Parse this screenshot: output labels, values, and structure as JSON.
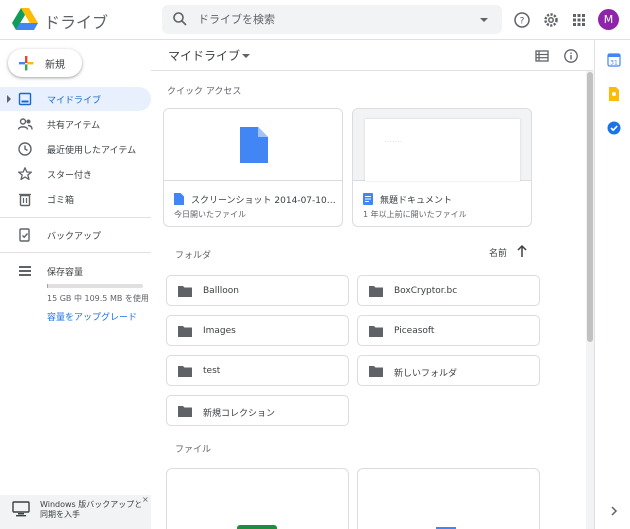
{
  "header": {
    "app_title": "ドライブ",
    "search_placeholder": "ドライブを検索",
    "avatar_initial": "M"
  },
  "sidebar": {
    "new_label": "新規",
    "items": [
      {
        "label": "マイドライブ",
        "icon": "my-drive-icon",
        "active": true
      },
      {
        "label": "共有アイテム",
        "icon": "shared-people-icon"
      },
      {
        "label": "最近使用したアイテム",
        "icon": "clock-icon"
      },
      {
        "label": "スター付き",
        "icon": "star-icon"
      },
      {
        "label": "ゴミ箱",
        "icon": "trash-icon"
      },
      {
        "label": "バックアップ",
        "icon": "backup-icon"
      },
      {
        "label": "保存容量",
        "icon": "storage-icon"
      }
    ],
    "storage": {
      "usage_text": "15 GB 中 109.5 MB を使用",
      "used_fraction": 0.007,
      "upgrade_link": "容量をアップグレード"
    },
    "backup_banner": {
      "text": "Windows 版バックアップと同期を入手",
      "close": "×"
    }
  },
  "main": {
    "title": "マイドライブ",
    "quick_access_label": "クイック アクセス",
    "quick_access": [
      {
        "name": "スクリーンショット 2014-07-10 01...",
        "sub": "今日開いたファイル",
        "type": "image",
        "color": "#4285f4"
      },
      {
        "name": "無題ドキュメント",
        "sub": "1 年以上前に開いたファイル",
        "type": "doc",
        "color": "#4285f4"
      }
    ],
    "folders_label": "フォルダ",
    "sort_label": "名前",
    "folders": [
      {
        "name": "Ballloon"
      },
      {
        "name": "BoxCryptor.bc"
      },
      {
        "name": "Images"
      },
      {
        "name": "Piceasoft"
      },
      {
        "name": "test"
      },
      {
        "name": "新しいフォルダ"
      },
      {
        "name": "新規コレクション"
      }
    ],
    "files_label": "ファイル"
  },
  "colors": {
    "accent": "#1a73e8",
    "active_nav_bg": "#e8f0fe",
    "avatar": "#8e24aa"
  }
}
